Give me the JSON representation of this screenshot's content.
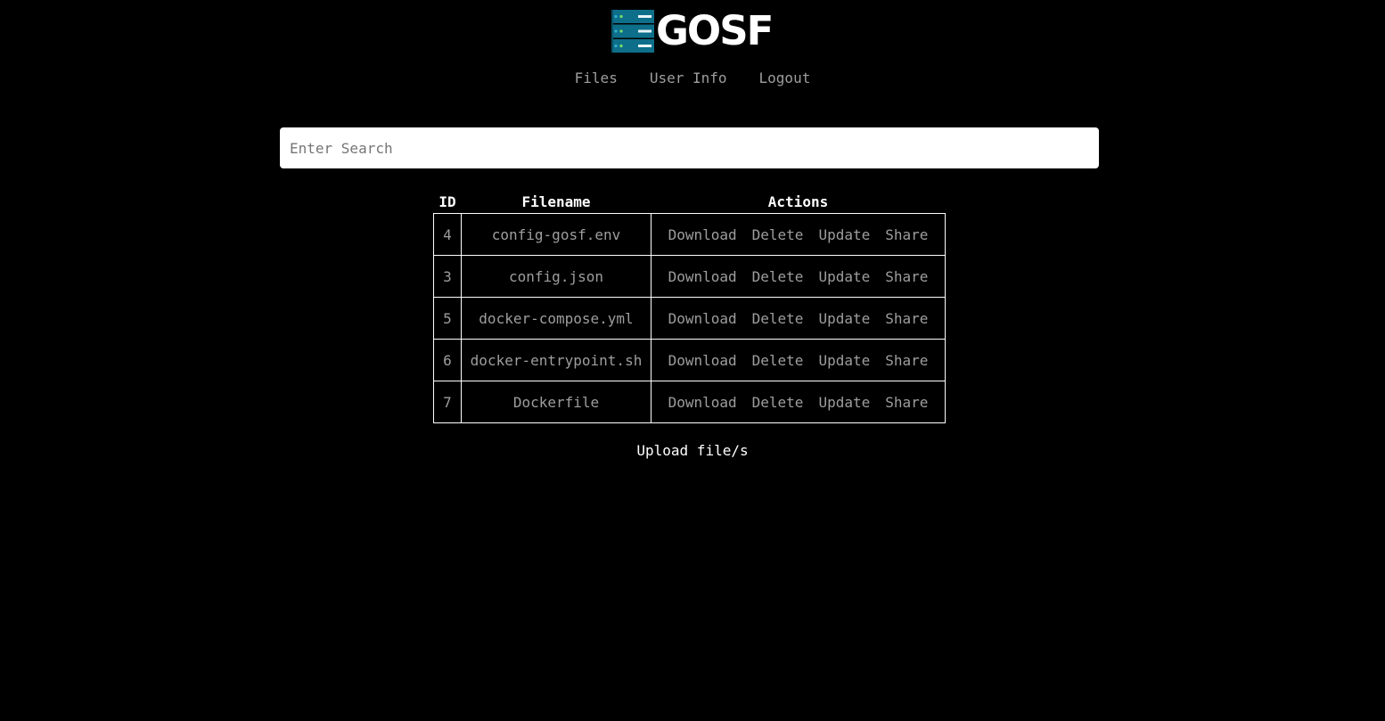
{
  "brand": {
    "name": "GOSF",
    "icon": "server-rack-icon",
    "colors": {
      "rack": "#0e6f8a",
      "rack_dark": "#0a5468",
      "led_green": "#7be06b",
      "slot": "#e8f4f7"
    }
  },
  "nav": {
    "files": "Files",
    "user_info": "User Info",
    "logout": "Logout"
  },
  "search": {
    "placeholder": "Enter Search",
    "value": ""
  },
  "table": {
    "headers": {
      "id": "ID",
      "filename": "Filename",
      "actions": "Actions"
    },
    "action_labels": {
      "download": "Download",
      "delete": "Delete",
      "update": "Update",
      "share": "Share"
    },
    "rows": [
      {
        "id": "4",
        "filename": "config-gosf.env"
      },
      {
        "id": "3",
        "filename": "config.json"
      },
      {
        "id": "5",
        "filename": "docker-compose.yml"
      },
      {
        "id": "6",
        "filename": "docker-entrypoint.sh"
      },
      {
        "id": "7",
        "filename": "Dockerfile"
      }
    ]
  },
  "upload": {
    "label": "Upload file/s"
  }
}
